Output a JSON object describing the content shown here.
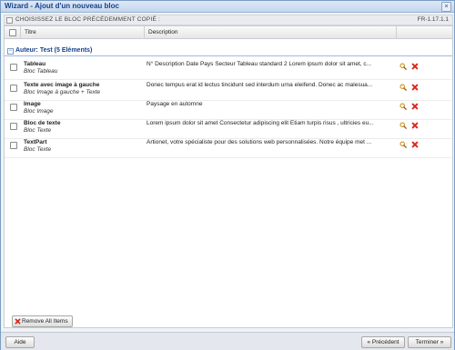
{
  "window": {
    "title": "Wizard - Ajout d'un nouveau bloc",
    "close_glyph": "×"
  },
  "step": {
    "label": "CHOISISSEZ LE BLOC PRÉCÉDEMMENT COPIÉ :",
    "version": "FR-1.17.1.1"
  },
  "table": {
    "columns": [
      "Titre",
      "Description"
    ],
    "group_label": "Auteur: Test (5 Eléments)",
    "group_toggle": "−",
    "rows": [
      {
        "title": "Tableau",
        "subtitle": "Bloc Tableau",
        "description": "N° Description Date Pays Secteur Tableau standard 2 Lorem ipsum dolor sit amet, c..."
      },
      {
        "title": "Texte avec image à gauche",
        "subtitle": "Bloc Image à gauche + Texte",
        "description": "Donec tempus erat id lectus tincidunt sed interdum urna eleifend. Donec ac malesua..."
      },
      {
        "title": "Image",
        "subtitle": "Bloc Image",
        "description": "Paysage en automne"
      },
      {
        "title": "Bloc de texte",
        "subtitle": "Bloc Texte",
        "description": "Lorem ipsum dolor sit amet Consectetur adipiscing elit Etiam turpis risus , ultricies eu..."
      },
      {
        "title": "TextPart",
        "subtitle": "Bloc Texte",
        "description": "Artionet, votre spécialiste pour des solutions web personnalisées. Notre équipe met ..."
      }
    ],
    "row_icons": [
      "magnifier-icon",
      "delete-x-icon"
    ]
  },
  "remove_all_label": "Remove All Items",
  "footer": {
    "help": "Aide",
    "prev": "« Précédent",
    "finish": "Terminer »"
  },
  "colors": {
    "title": "#15428b",
    "delete": "#d9261c",
    "magnifier": "#c88a1a"
  }
}
